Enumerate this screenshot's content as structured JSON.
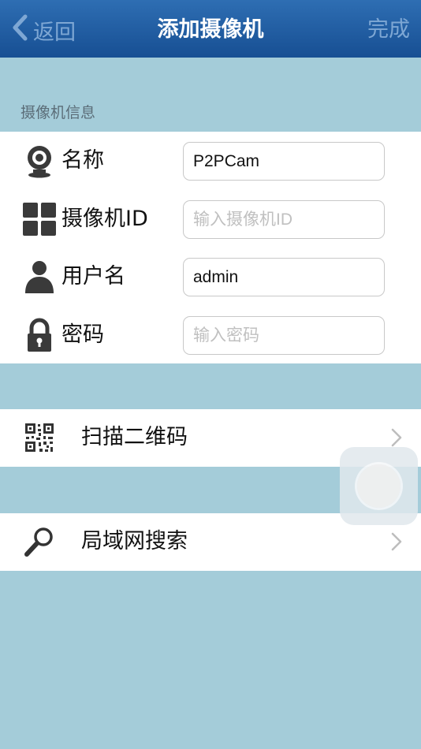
{
  "nav": {
    "back_label": "返回",
    "title": "添加摄像机",
    "done_label": "完成"
  },
  "section": {
    "header": "摄像机信息"
  },
  "form": {
    "name_label": "名称",
    "name_value": "P2PCam",
    "id_label": "摄像机ID",
    "id_placeholder": "输入摄像机ID",
    "user_label": "用户名",
    "user_value": "admin",
    "password_label": "密码",
    "password_placeholder": "输入密码"
  },
  "actions": {
    "scan_label": "扫描二维码",
    "lan_label": "局域网搜索"
  },
  "icons": [
    "chevron-left-icon",
    "webcam-icon",
    "grid-icon",
    "user-icon",
    "lock-icon",
    "qr-code-icon",
    "magnifier-icon",
    "chevron-right-icon"
  ],
  "colors": {
    "nav_bar": "#1f5ea5",
    "background": "#a4ccd9",
    "nav_text": "#7ea7d4"
  }
}
